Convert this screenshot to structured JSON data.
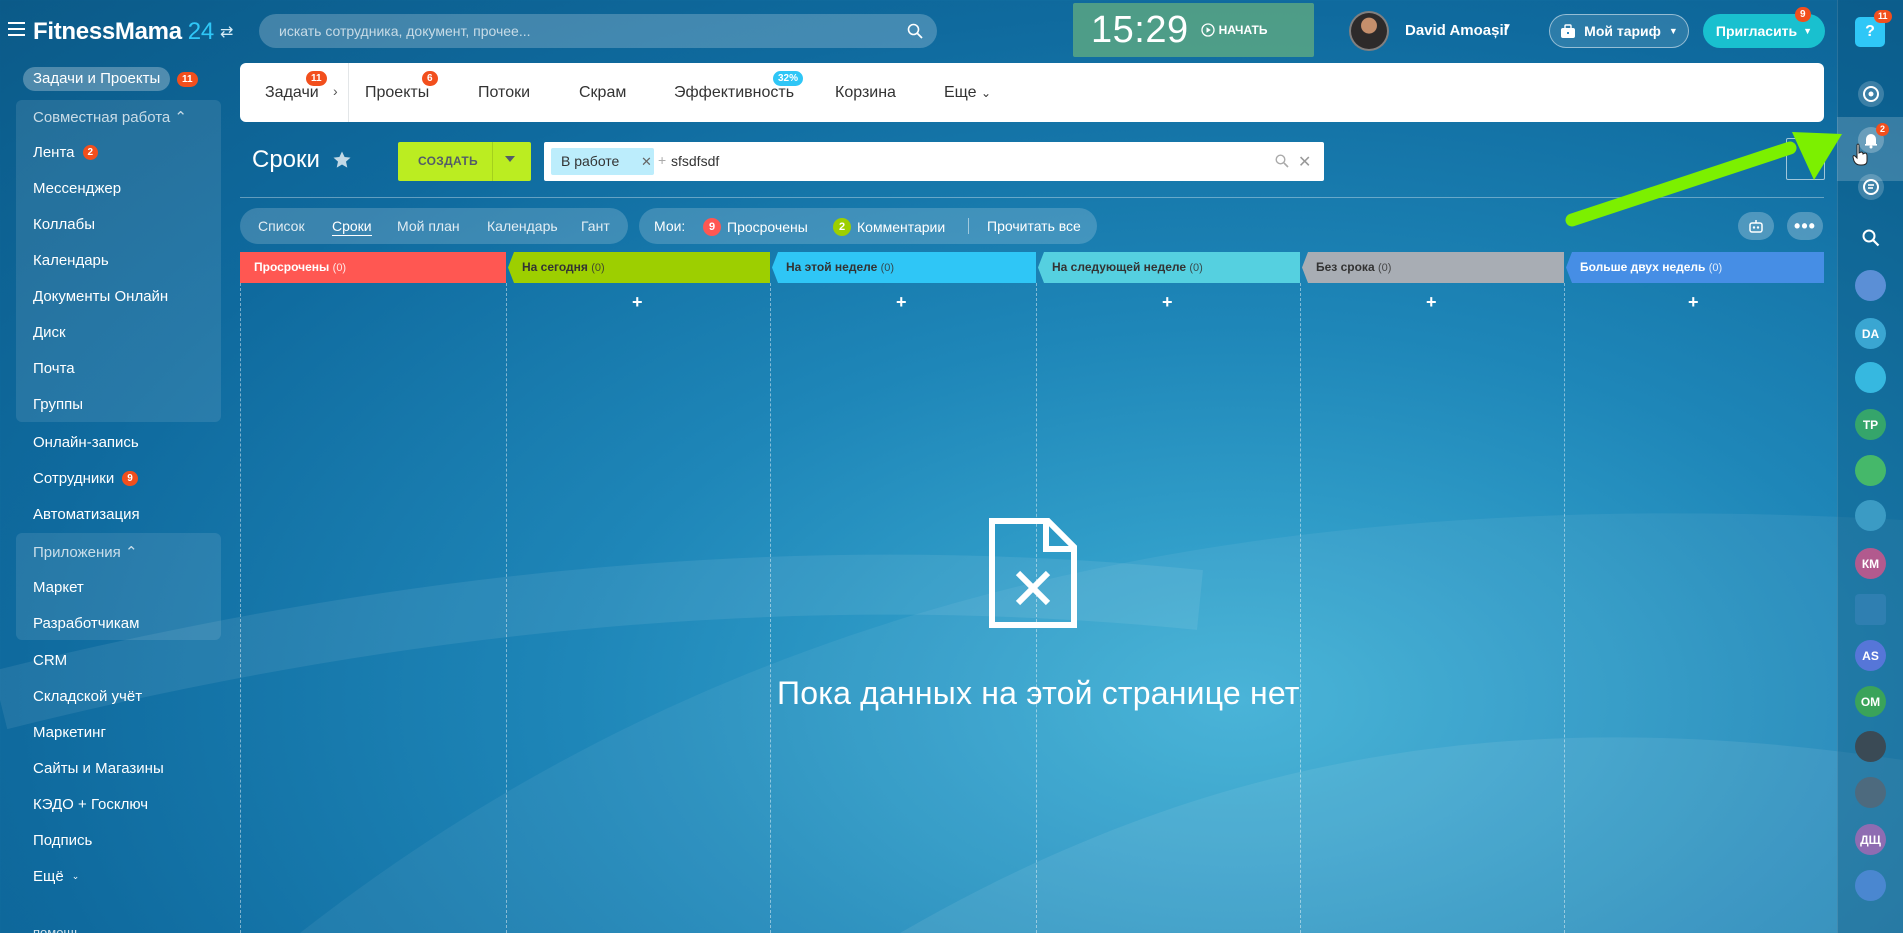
{
  "header": {
    "logo_name": "FitnessMama",
    "logo_num": "24",
    "search_placeholder": "искать сотрудника, документ, прочее...",
    "timer_time": "15:29",
    "timer_start": "НАЧАТЬ",
    "user_name": "David Amoașii",
    "tariff_label": "Мой тариф",
    "invite_label": "Пригласить",
    "invite_badge": "9"
  },
  "sidebar": {
    "pinned": {
      "label": "Задачи и Проекты",
      "badge": "11"
    },
    "group1_title": "Совместная работа",
    "group1_items": [
      {
        "label": "Лента",
        "badge": "2"
      },
      {
        "label": "Мессенджер"
      },
      {
        "label": "Коллабы"
      },
      {
        "label": "Календарь"
      },
      {
        "label": "Документы Онлайн"
      },
      {
        "label": "Диск"
      },
      {
        "label": "Почта"
      },
      {
        "label": "Группы"
      }
    ],
    "middle_items": [
      {
        "label": "Онлайн-запись"
      },
      {
        "label": "Сотрудники",
        "badge": "9"
      },
      {
        "label": "Автоматизация"
      }
    ],
    "group2_title": "Приложения",
    "group2_items": [
      {
        "label": "Маркет"
      },
      {
        "label": "Разработчикам"
      }
    ],
    "bottom_items": [
      {
        "label": "CRM"
      },
      {
        "label": "Складской учёт"
      },
      {
        "label": "Маркетинг"
      },
      {
        "label": "Сайты и Магазины"
      },
      {
        "label": "КЭДО + Госключ"
      },
      {
        "label": "Подпись"
      },
      {
        "label": "Ещё"
      }
    ],
    "help_label": "помощь"
  },
  "topnav": {
    "items": [
      {
        "label": "Задачи",
        "badge": "11"
      },
      {
        "label": "Проекты",
        "badge": "6"
      },
      {
        "label": "Потоки"
      },
      {
        "label": "Скрам"
      },
      {
        "label": "Эффективность",
        "badge": "32%"
      },
      {
        "label": "Корзина"
      },
      {
        "label": "Еще"
      }
    ]
  },
  "toolbar": {
    "title": "Сроки",
    "create_label": "СОЗДАТЬ",
    "filter_chip": "В работе",
    "filter_text": "sfsdfsdf"
  },
  "views": {
    "items": [
      "Список",
      "Сроки",
      "Мой план",
      "Календарь",
      "Гант"
    ],
    "active": "Сроки",
    "counters_label": "Мои:",
    "overdue": {
      "count": "9",
      "label": "Просрочены"
    },
    "comments": {
      "count": "2",
      "label": "Комментарии"
    },
    "read_all": "Прочитать все"
  },
  "kanban": {
    "columns": [
      {
        "name": "Просрочены",
        "count": "(0)",
        "color": "#ff5752"
      },
      {
        "name": "На сегодня",
        "count": "(0)",
        "color": "#9dcf00"
      },
      {
        "name": "На этой неделе",
        "count": "(0)",
        "color": "#2fc6f6"
      },
      {
        "name": "На следующей неделе",
        "count": "(0)",
        "color": "#55d0e0"
      },
      {
        "name": "Без срока",
        "count": "(0)",
        "color": "#a8adb4"
      },
      {
        "name": "Больше двух недель",
        "count": "(0)",
        "color": "#468ee5"
      }
    ],
    "empty_text": "Пока данных на этой странице нет"
  },
  "rightbar": {
    "help_badge": "11",
    "bell_badge": "2",
    "avatars": [
      {
        "initials": "",
        "color": "#5b8fd6"
      },
      {
        "initials": "DA",
        "color": "#3aa6d2"
      },
      {
        "initials": "",
        "color": "#36b8e0"
      },
      {
        "initials": "TP",
        "color": "#35a56b"
      },
      {
        "initials": "",
        "color": "#45b86a"
      },
      {
        "initials": "",
        "color": "#3b9bc4"
      },
      {
        "initials": "КМ",
        "color": "#b25a8e"
      },
      {
        "initials": "",
        "color": "#2f7fb1"
      },
      {
        "initials": "AS",
        "color": "#5676d8"
      },
      {
        "initials": "ОМ",
        "color": "#3aa35a"
      },
      {
        "initials": "",
        "color": "#3a4a55"
      },
      {
        "initials": "",
        "color": "#4d6a7e"
      },
      {
        "initials": "ДЩ",
        "color": "#8e6cb2"
      },
      {
        "initials": "",
        "color": "#4a87d0"
      }
    ]
  }
}
